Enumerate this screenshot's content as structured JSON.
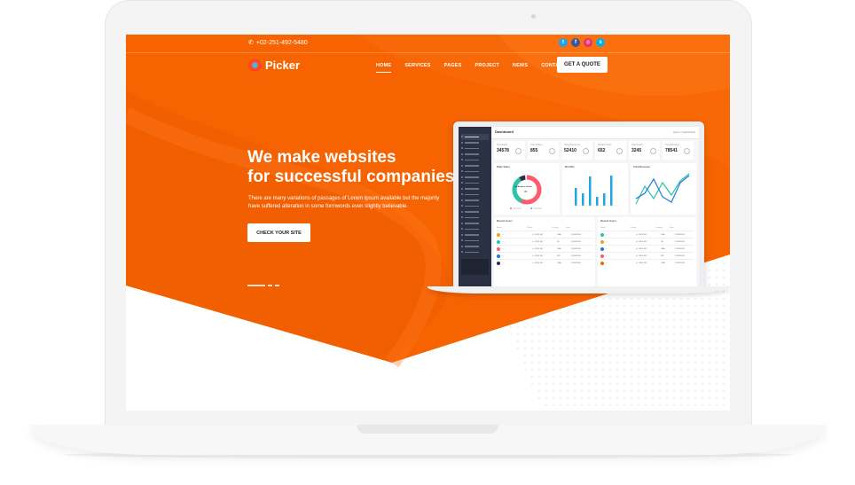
{
  "site": {
    "phone": "+02-251-492-5480",
    "socials": [
      {
        "icon": "twitter-icon",
        "glyph": "t",
        "color": "#1da1f2"
      },
      {
        "icon": "facebook-icon",
        "glyph": "f",
        "color": "#3b5998"
      },
      {
        "icon": "instagram-icon",
        "glyph": "◎",
        "color": "#e1306c"
      },
      {
        "icon": "skype-icon",
        "glyph": "s",
        "color": "#00aff0"
      }
    ],
    "logo": "Picker",
    "menu": [
      "HOME",
      "SERVICES",
      "PAGES",
      "PROJECT",
      "NEWS",
      "CONTACT"
    ],
    "active_menu": "HOME",
    "quote_button": "GET A QUOTE",
    "hero_title_line1": "We make websites",
    "hero_title_line2": "for successful companies",
    "hero_subtitle": "There are many variations of passages of Lorem Ipsum available but the majority have suffered alteration in some formwords even slightly believable.",
    "hero_button": "CHECK YOUR SITE"
  },
  "colors": {
    "orange": "#f66300",
    "orange_dark": "#e55a00",
    "white": "#ffffff"
  },
  "dashboard": {
    "title": "Dashboard",
    "crumb": "Home / Dashboard",
    "stats": [
      {
        "label": "Total Sales",
        "value": "34578"
      },
      {
        "label": "Total Orders",
        "value": "855"
      },
      {
        "label": "Total Customers",
        "value": "52410"
      },
      {
        "label": "Monthly Visits",
        "value": "652"
      },
      {
        "label": "Total Leads",
        "value": "3245"
      },
      {
        "label": "Total Earnings",
        "value": "78541"
      }
    ],
    "panels": {
      "daily": "Daily Sales",
      "monthly": "Monthly",
      "revenue": "Total Revenue",
      "recent1": "Recent Users",
      "recent2": "Recent Users"
    },
    "donut_label": "On-Browser Visitor",
    "donut_value": "36"
  }
}
